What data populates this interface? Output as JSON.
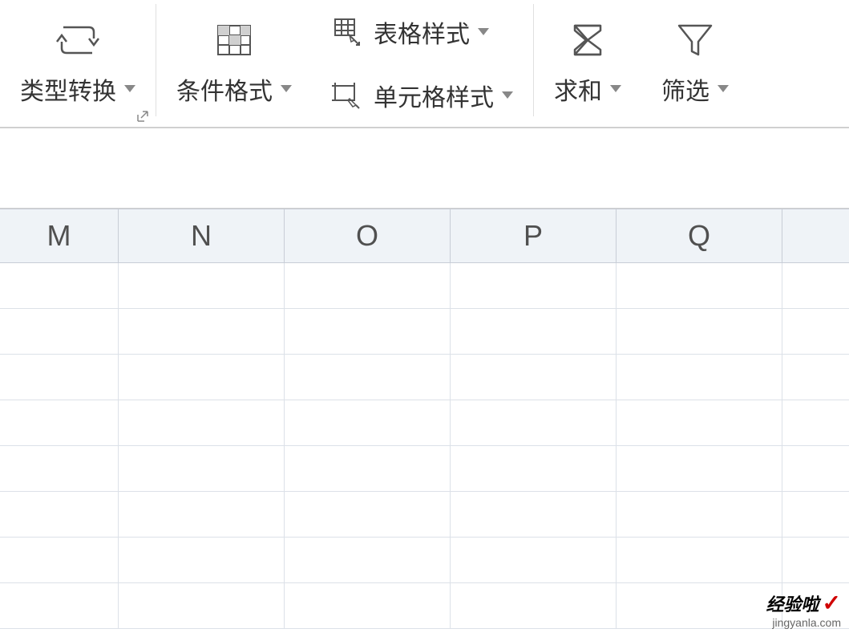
{
  "ribbon": {
    "type_convert": "类型转换",
    "conditional_format": "条件格式",
    "table_style": "表格样式",
    "cell_style": "单元格样式",
    "sum": "求和",
    "filter": "筛选"
  },
  "columns": [
    "M",
    "N",
    "O",
    "P",
    "Q"
  ],
  "watermark": {
    "title": "经验啦",
    "url": "jingyanla.com"
  }
}
